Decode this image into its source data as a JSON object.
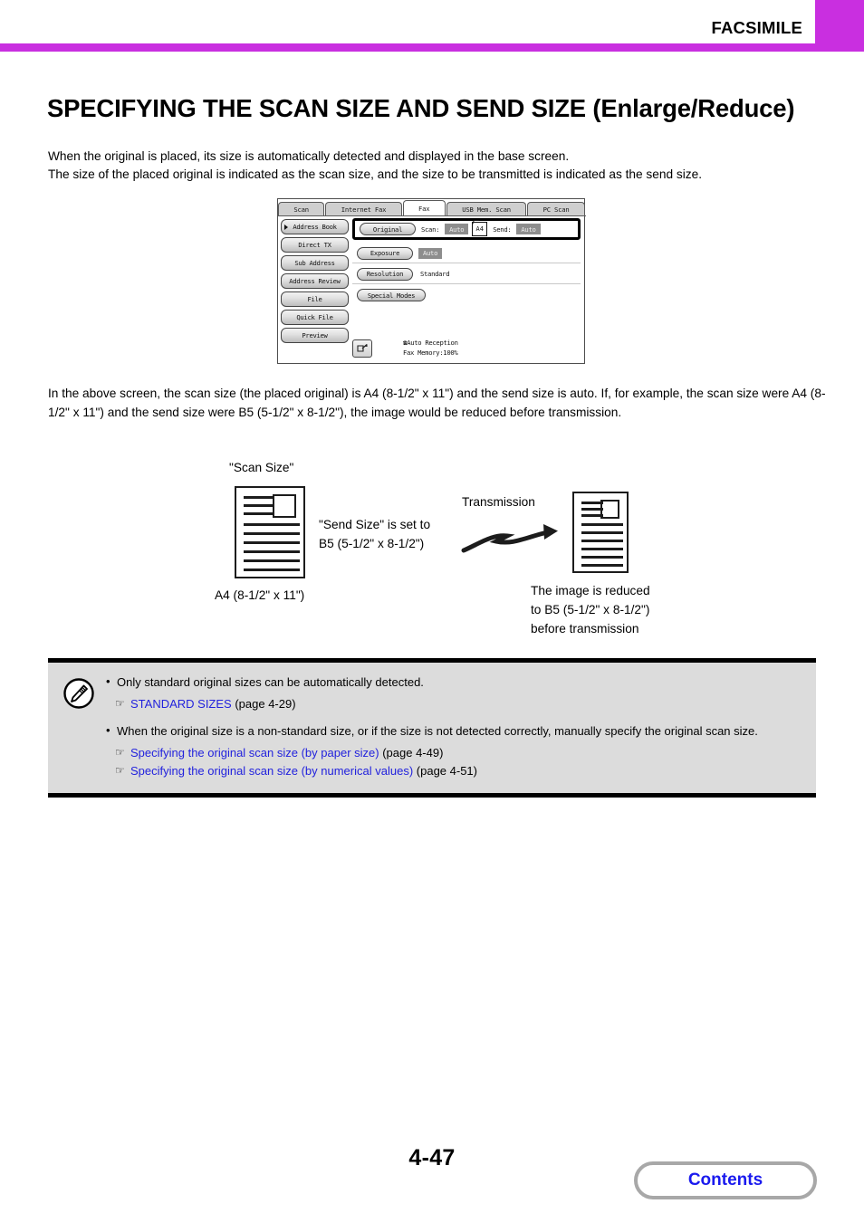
{
  "header": {
    "title": "FACSIMILE",
    "accent_color": "#c92fe0"
  },
  "heading": "SPECIFYING THE SCAN SIZE AND SEND SIZE (Enlarge/Reduce)",
  "intro": "When the original is placed, its size is automatically detected and displayed in the base screen.\nThe size of the placed original is indicated as the scan size, and the size to be transmitted is indicated as the send size.",
  "device_screen": {
    "tabs": [
      {
        "label": "Scan",
        "active": false
      },
      {
        "label": "Internet Fax",
        "active": false
      },
      {
        "label": "Fax",
        "active": true
      },
      {
        "label": "USB Mem. Scan",
        "active": false
      },
      {
        "label": "PC Scan",
        "active": false
      }
    ],
    "side_buttons": [
      {
        "label": "Address Book",
        "selected": true
      },
      {
        "label": "Direct TX",
        "selected": false
      },
      {
        "label": "Sub Address",
        "selected": false
      },
      {
        "label": "Address Review",
        "selected": false
      },
      {
        "label": "File",
        "selected": false
      },
      {
        "label": "Quick File",
        "selected": false
      },
      {
        "label": "Preview",
        "selected": false
      }
    ],
    "original_row": {
      "button": "Original",
      "scan_label": "Scan:",
      "scan_value": "Auto",
      "scan_size": "A4",
      "send_label": "Send:",
      "send_value": "Auto"
    },
    "exposure_row": {
      "button": "Exposure",
      "value": "Auto"
    },
    "resolution_row": {
      "button": "Resolution",
      "value": "Standard"
    },
    "special_modes_row": {
      "button": "Special Modes"
    },
    "footer": {
      "reception": "Auto Reception",
      "memory": "Fax Memory:100%",
      "icon": "fax-forward-icon"
    }
  },
  "mid_paragraph": "In the above screen, the scan size (the placed original) is A4 (8-1/2\" x 11\") and the send size is auto. If, for example, the scan size were A4 (8-1/2\" x 11\") and the send size were B5 (5-1/2\" x 8-1/2\"), the image would be reduced before transmission.",
  "diagram": {
    "scan_size_label": "\"Scan Size\"",
    "a4_label": "A4 (8-1/2\" x 11\")",
    "send_size_label": "\"Send Size\" is set to\nB5 (5-1/2\" x 8-1/2\")",
    "transmission_label": "Transmission",
    "reduced_label": "The image is reduced\nto B5 (5-1/2\" x 8-1/2\")\nbefore transmission"
  },
  "note": {
    "icon": "pencil-note-icon",
    "item1": "Only standard original sizes can be automatically detected.",
    "item1_ref_link": "STANDARD SIZES",
    "item1_ref_page": "(page 4-29)",
    "item2": "When the original size is a non-standard size, or if the size is not detected correctly, manually specify the original scan size.",
    "item2_ref1_link": "Specifying the original scan size (by paper size)",
    "item2_ref1_page": "(page 4-49)",
    "item2_ref2_link": "Specifying the original scan size (by numerical values)",
    "item2_ref2_page": "(page 4-51)"
  },
  "footer": {
    "page_number": "4-47",
    "contents_label": "Contents"
  }
}
